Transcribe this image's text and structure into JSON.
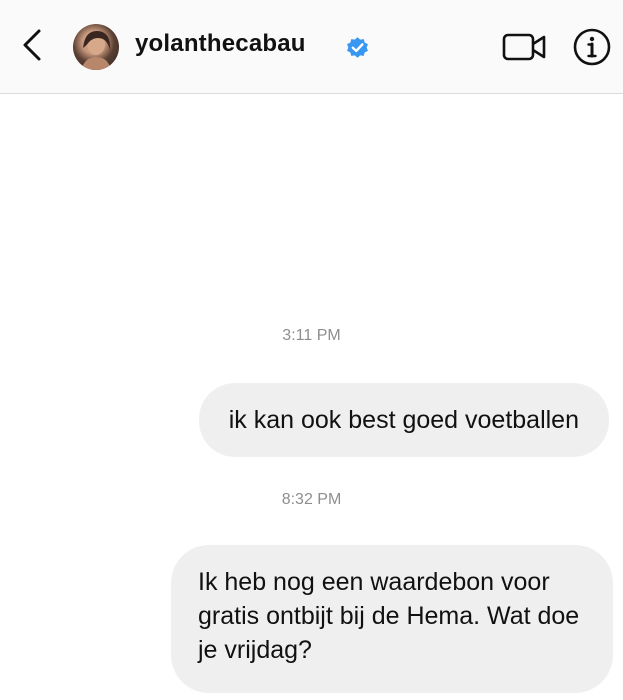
{
  "header": {
    "username": "yolanthecabau",
    "verified": true,
    "back_icon": "chevron-left-icon",
    "video_icon": "video-camera-icon",
    "info_icon": "info-icon",
    "verified_color": "#3897f0"
  },
  "messages": [
    {
      "timestamp": "3:11 PM",
      "text": "ik kan ook best goed voetballen",
      "sender": "me"
    },
    {
      "timestamp": "8:32 PM",
      "text": "Ik heb nog een waardebon voor gratis ontbijt bij de Hema. Wat doe je vrijdag?",
      "sender": "me"
    }
  ],
  "colors": {
    "bubble_background": "#efefef",
    "timestamp_text": "#8e8e8e",
    "header_background": "#fafafa"
  }
}
